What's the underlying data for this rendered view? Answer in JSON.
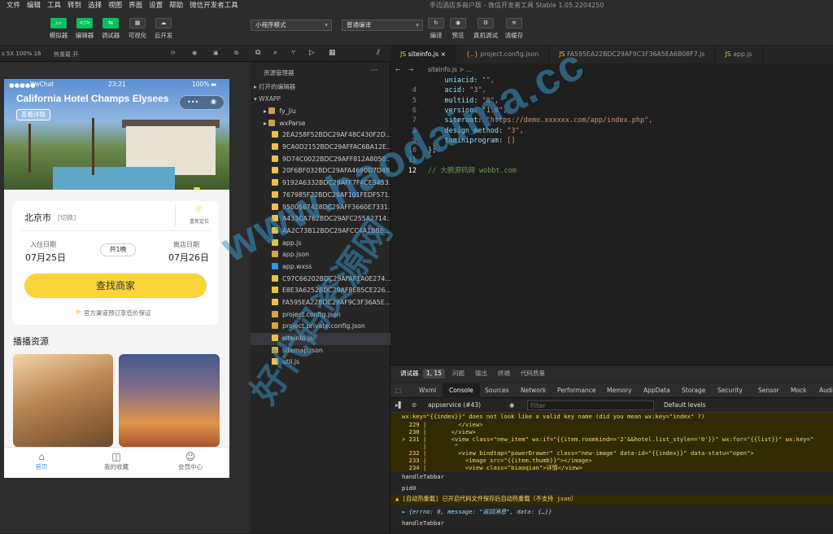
{
  "menubar": {
    "items": [
      "文件",
      "编辑",
      "工具",
      "转到",
      "选择",
      "视图",
      "界面",
      "设置",
      "帮助",
      "微信开发者工具"
    ],
    "title": "手边酒店多商户版 - 微信开发者工具 Stable 1.05.2204250"
  },
  "toolbar": {
    "buttons": [
      "模拟器",
      "编辑器",
      "调试器",
      "可视化",
      "云开发"
    ],
    "mode_select": "小程序模式",
    "compile_select": "普通编译",
    "right_buttons": [
      "编译",
      "预览",
      "真机调试",
      "清缓存"
    ]
  },
  "simbar": {
    "device": "s 5X 100% 16",
    "hotreload": "热重载 开"
  },
  "phone": {
    "status_carrier": "WeChat",
    "status_time": "23:21",
    "status_battery": "100%",
    "hero_title": "California Hotel Champs Elysees",
    "hero_button": "查看详情",
    "city": "北京市",
    "city_switch": "[切换]",
    "relocate": "重新定位",
    "checkin_label": "入住日期",
    "checkin_value": "07月25日",
    "nights": "共1晚",
    "checkout_label": "离店日期",
    "checkout_value": "07月26日",
    "find_button": "查找商家",
    "guarantee": "官方渠道预订享低价保证",
    "section_title": "播播资源",
    "nav": [
      "首页",
      "我的收藏",
      "会员中心"
    ]
  },
  "explorer": {
    "title": "资源管理器",
    "open_editors": "打开的编辑器",
    "root": "WXAPP",
    "files": [
      {
        "name": "fy_jiu",
        "type": "folder"
      },
      {
        "name": "wxParse",
        "type": "folder"
      },
      {
        "name": "2EA258F52BDC29AF48C430F2D...",
        "type": "file"
      },
      {
        "name": "9CA0D2152BDC29AFFAC6BA12E...",
        "type": "file"
      },
      {
        "name": "9D74C0022BDC29AFF812A8050...",
        "type": "file"
      },
      {
        "name": "20F6BF032BDC29AFA4690D7D4B...",
        "type": "file"
      },
      {
        "name": "9192A6332BDC29AFF7F4CE3453...",
        "type": "file"
      },
      {
        "name": "767985F22BDC29AF101FEDF571...",
        "type": "file"
      },
      {
        "name": "9500667428DC29AFF3660E7331...",
        "type": "file"
      },
      {
        "name": "A433CA762BDC29AFC255A2714...",
        "type": "file"
      },
      {
        "name": "AA2C73B12BDC29AFCC4A1BB6...",
        "type": "file"
      },
      {
        "name": "app.js",
        "type": "js"
      },
      {
        "name": "app.json",
        "type": "json"
      },
      {
        "name": "app.wxss",
        "type": "wxss"
      },
      {
        "name": "C97C66202BDC29AFAF1A0E274...",
        "type": "file"
      },
      {
        "name": "E8E3A6252BDC29AF8E85CE226...",
        "type": "file"
      },
      {
        "name": "FA595EA22BDC29AF9C3F36A5E...",
        "type": "file"
      },
      {
        "name": "project.config.json",
        "type": "json"
      },
      {
        "name": "project.private.config.json",
        "type": "json"
      },
      {
        "name": "siteinfo.js",
        "type": "js"
      },
      {
        "name": "sitemap.json",
        "type": "json"
      },
      {
        "name": "util.js",
        "type": "js"
      }
    ]
  },
  "editor": {
    "tabs": [
      "siteinfo.js",
      "project.config.json",
      "FA595EA22BDC29AF9C3F36A5EA6B08F7.js",
      "app.js"
    ],
    "breadcrumb": "siteinfo.js > ...",
    "lines": [
      {
        "n": "",
        "code": "    uniacid: \"\","
      },
      {
        "n": "4",
        "code": "    acid: \"3\","
      },
      {
        "n": "5",
        "code": "    multiid: \"0\","
      },
      {
        "n": "6",
        "code": "    version: \"1.0\","
      },
      {
        "n": "7",
        "code": "    siteroot: \"https://demo.xxxxxx.com/app/index.php\","
      },
      {
        "n": "8",
        "code": "    design_method: \"3\","
      },
      {
        "n": "9",
        "code": "    tominiprogram: []"
      },
      {
        "n": "10",
        "code": "};"
      },
      {
        "n": "11",
        "code": ""
      },
      {
        "n": "12",
        "code": "// 大鹏源码网 wobbt.com"
      }
    ]
  },
  "devtools": {
    "top_tabs": [
      "调试器",
      "1, 15",
      "问题",
      "输出",
      "终端",
      "代码质量"
    ],
    "tabs": [
      "Wxml",
      "Console",
      "Sources",
      "Network",
      "Performance",
      "Memory",
      "AppData",
      "Storage",
      "Security",
      "Sensor",
      "Mock",
      "Audits"
    ],
    "context": "appservice (#43)",
    "filter_placeholder": "Filter",
    "levels": "Default levels",
    "console_lines": [
      "wx:key=\"{{index}}\" does not look like a valid key name (did you mean wx:key=\"index\" ?)",
      "  229 |         </view>",
      "  230 |       </view>",
      "> 231 |       <view class=\"new_item\" wx:if=\"{{item.roomkind=='2'&&hotel.list_style=='0'}}\" wx:for=\"{{list}}\" wx:key=\"",
      "      |        ^",
      "  232 |         <view bindtap=\"powerDrawer\" class=\"new-image\" data-id=\"{{index}}\" data-statu=\"open\">",
      "  233 |           <image src=\"{{item.thumb}}\"></image>",
      "  234 |           <view class=\"biaoqian\">详情</view>",
      "handleTabbar",
      "pid0",
      "[自动热重载] 已开启代码文件保存后自动热重载（不支持 json）",
      "{errno: 0, message: \"返回消息\", data: {…}}",
      "handleTabbar"
    ]
  },
  "watermark": "www.haodaima.cc",
  "watermark2": "好代码资源网"
}
